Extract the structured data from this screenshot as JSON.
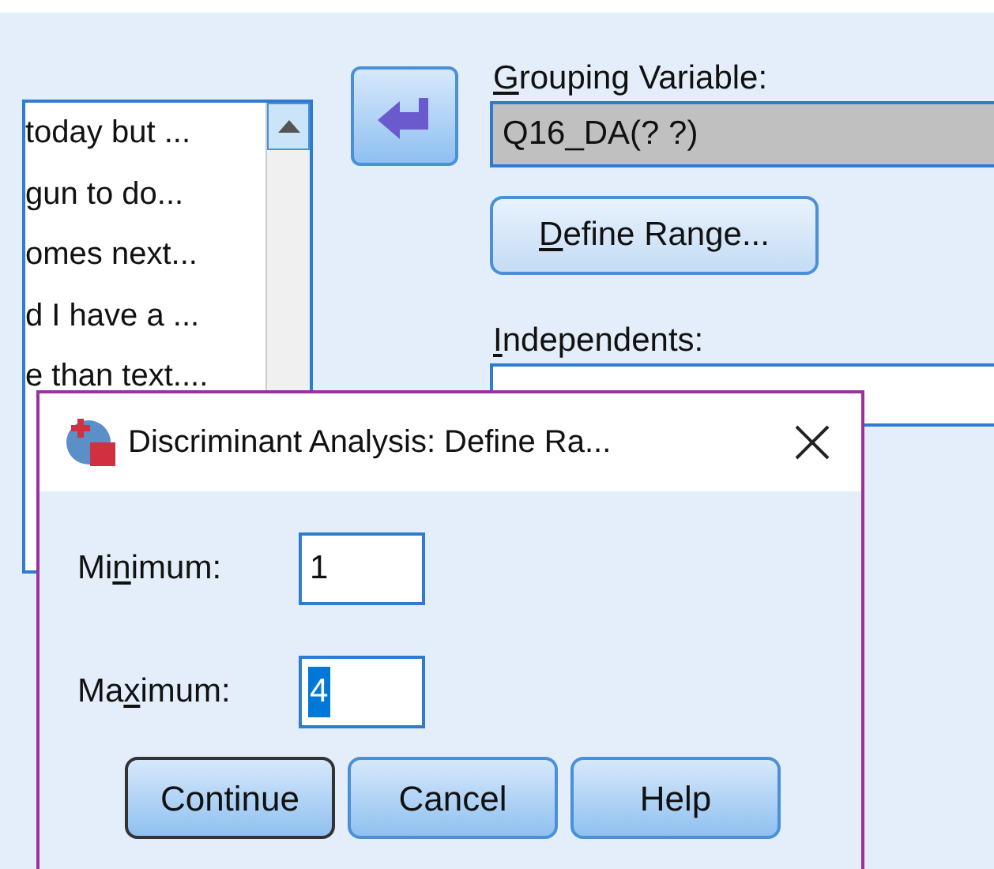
{
  "variable_list": {
    "rows": [
      "today but ...",
      "gun to do...",
      "omes next...",
      "d I have a ...",
      "e than text...."
    ]
  },
  "grouping_variable": {
    "label": {
      "key": "G",
      "after": "rouping Variable:"
    },
    "value": "Q16_DA(? ?)"
  },
  "define_range_button": {
    "key": "D",
    "after": "efine Range..."
  },
  "independents": {
    "label": {
      "key": "I",
      "after": "ndependents:"
    }
  },
  "dialog": {
    "title": "Discriminant Analysis: Define Ra...",
    "fields": [
      {
        "label": {
          "before": "Mi",
          "key": "n",
          "after": "imum:"
        },
        "value": "1",
        "selected": false
      },
      {
        "label": {
          "before": "Ma",
          "key": "x",
          "after": "imum:"
        },
        "value": "4",
        "selected": true
      }
    ],
    "buttons": [
      {
        "label": "Continue",
        "default": true
      },
      {
        "label": "Cancel",
        "default": false
      },
      {
        "label": "Help",
        "default": false
      }
    ]
  }
}
